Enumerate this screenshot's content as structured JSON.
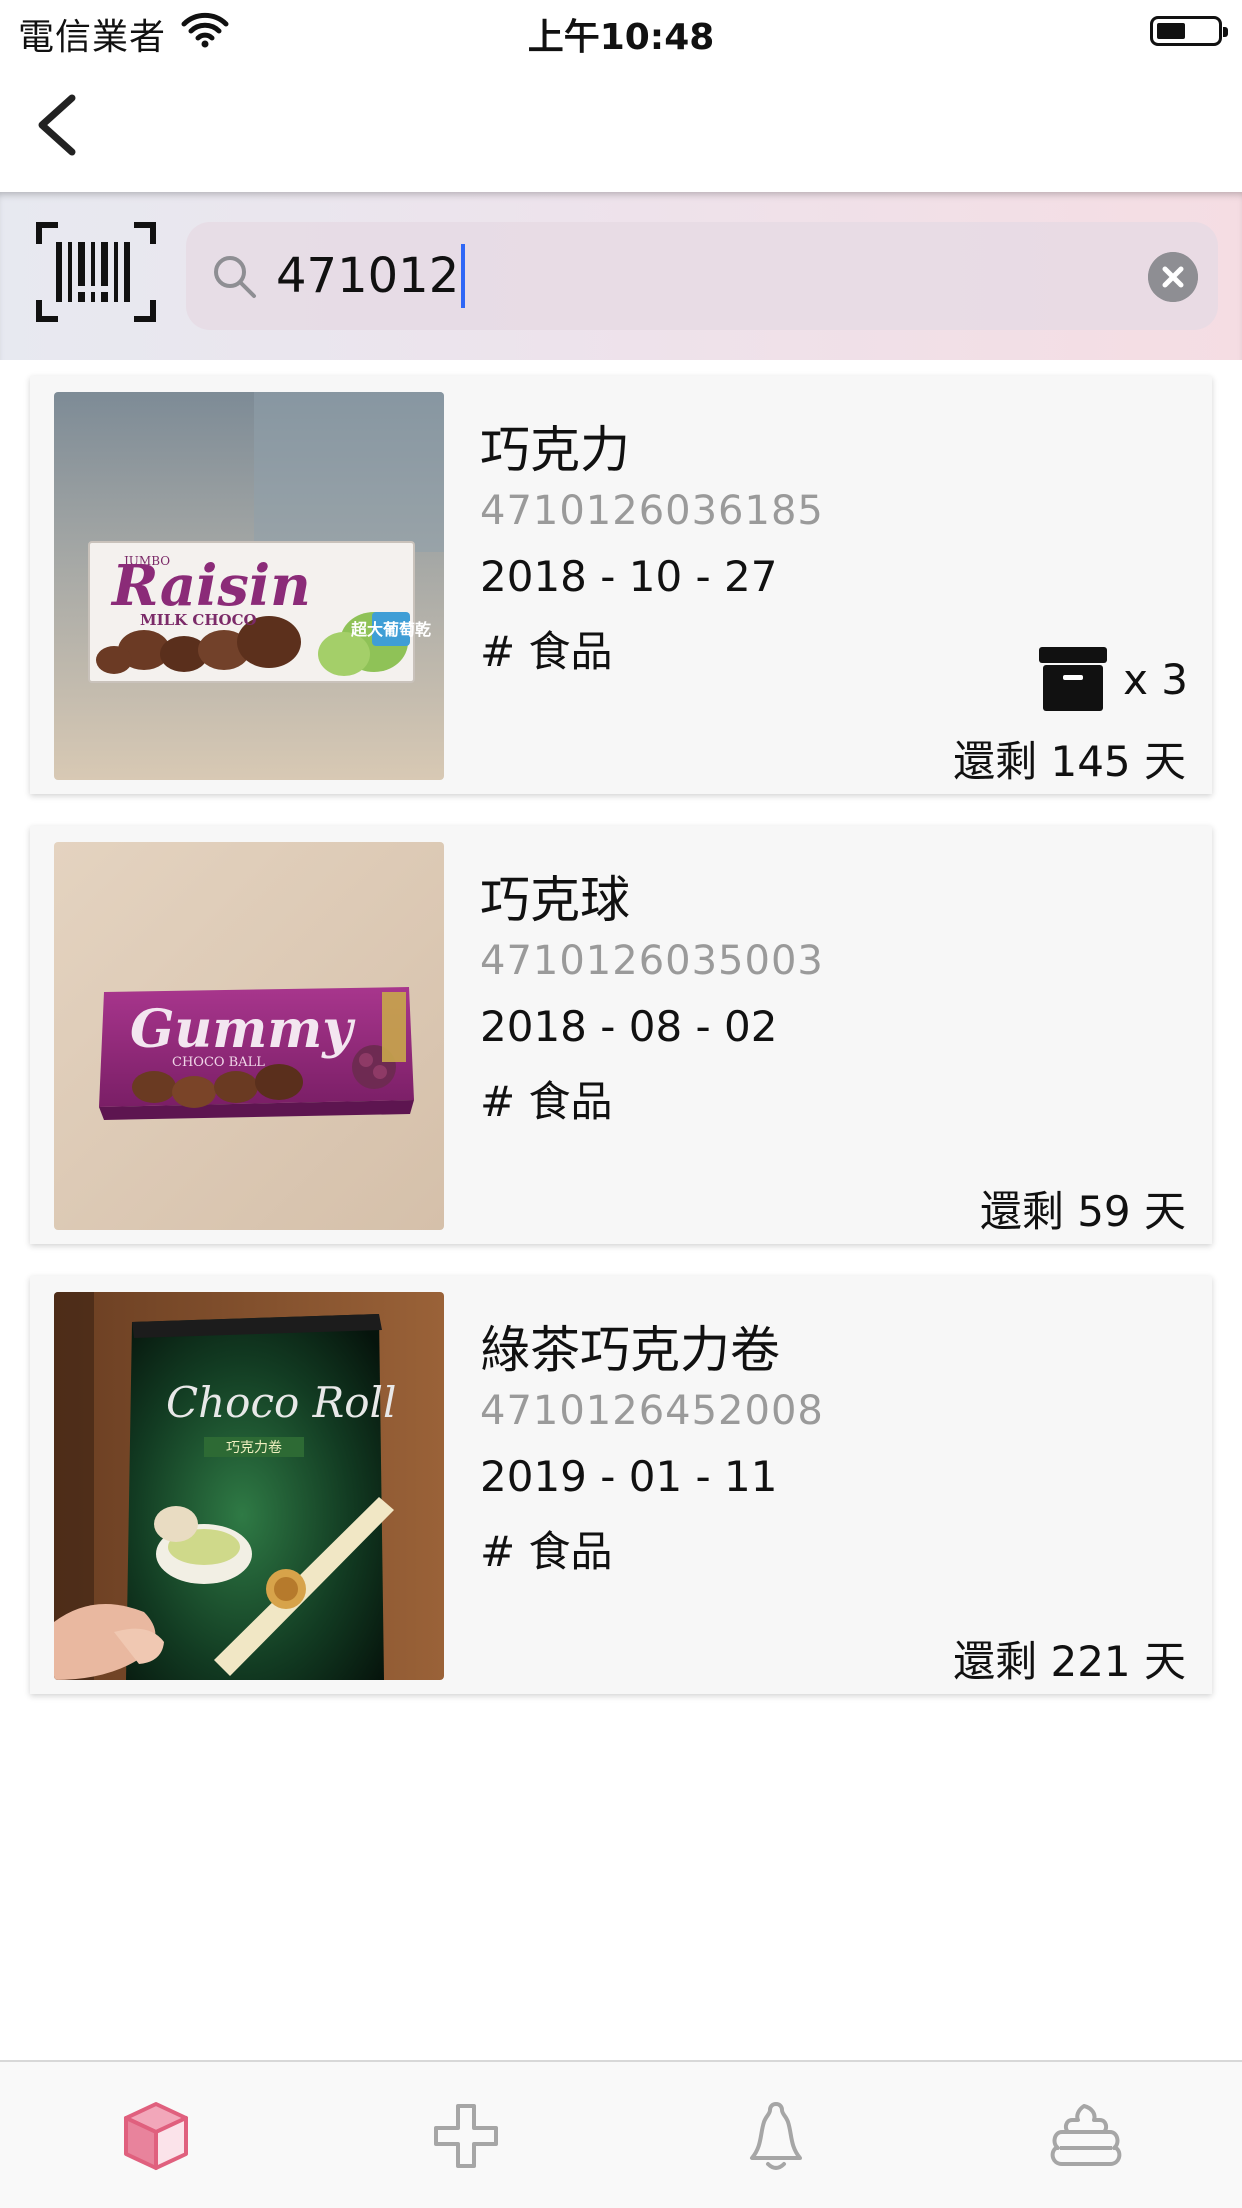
{
  "status_bar": {
    "carrier": "電信業者",
    "time": "上午10:48"
  },
  "search": {
    "query": "471012"
  },
  "items": [
    {
      "name": "巧克力",
      "barcode": "4710126036185",
      "date": "2018 - 10 - 27",
      "tag": "# 食品",
      "stock_count": "x 3",
      "remaining": "還剩 145 天",
      "image_text": {
        "top": "JUMBO",
        "brand": "Raisin",
        "sub": "MILK CHOCO",
        "badge": "超大葡萄乾"
      }
    },
    {
      "name": "巧克球",
      "barcode": "4710126035003",
      "date": "2018 - 08 - 02",
      "tag": "# 食品",
      "remaining": "還剩 59 天",
      "image_text": {
        "brand": "Gummy",
        "sub": "CHOCO BALL"
      }
    },
    {
      "name": "綠茶巧克力卷",
      "barcode": "4710126452008",
      "date": "2019 - 01 - 11",
      "tag": "# 食品",
      "remaining": "還剩 221 天",
      "image_text": {
        "brand": "Choco Roll",
        "sub": "巧克力卷"
      }
    }
  ],
  "tabs": [
    {
      "icon": "box-icon",
      "active": true
    },
    {
      "icon": "plus-icon",
      "active": false
    },
    {
      "icon": "bell-icon",
      "active": false
    },
    {
      "icon": "poop-icon",
      "active": false
    }
  ],
  "colors": {
    "accent": "#e0607e",
    "tab_inactive": "#a6a6a6",
    "secondary_text": "#9a9a9a",
    "caret": "#2f67f6"
  }
}
